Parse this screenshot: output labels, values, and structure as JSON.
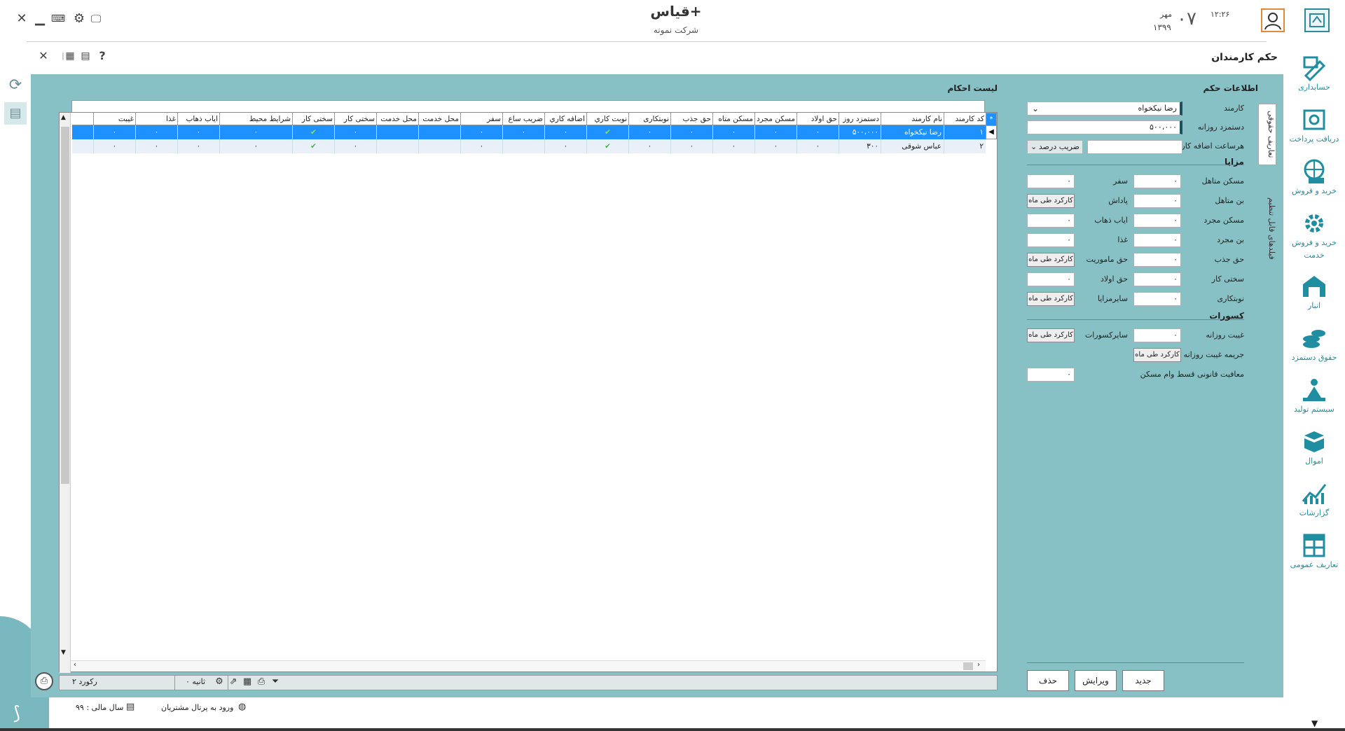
{
  "app": {
    "title": "قیاس+",
    "company": "شرکت نمونه",
    "time": "۱۲:۲۶",
    "day": "۰۷",
    "month": "مهر",
    "year": "۱۳۹۹"
  },
  "page_title": "حکم کارمندان",
  "form": {
    "section_title": "اطلاعات حکم",
    "employee_label": "کارمند",
    "employee_value": "رضا نیکخواه",
    "daily_wage_label": "دستمزد روزانه",
    "daily_wage_value": "۵۰۰،۰۰۰",
    "overtime_rate_label": "هرساعت اضافه کار",
    "overtime_rate_value": "",
    "overtime_mode": "ضریب درصد",
    "benefits_title": "مزایا",
    "deductions_title": "کسورات",
    "benefits_right": [
      {
        "label": "مسکن متاهل",
        "value": "۰"
      },
      {
        "label": "بن متاهل",
        "value": "۰"
      },
      {
        "label": "مسکن مجرد",
        "value": "۰"
      },
      {
        "label": "بن مجرد",
        "value": "۰"
      },
      {
        "label": "حق جذب",
        "value": "۰"
      },
      {
        "label": "سختی کار",
        "value": "۰"
      },
      {
        "label": "نوبتکاری",
        "value": "۰"
      }
    ],
    "benefits_left": [
      {
        "label": "سفر",
        "value": "۰",
        "button": ""
      },
      {
        "label": "پاداش",
        "value": "",
        "button": "کارکرد طی ماه"
      },
      {
        "label": "ایاب ذهاب",
        "value": "۰",
        "button": ""
      },
      {
        "label": "غذا",
        "value": "۰",
        "button": ""
      },
      {
        "label": "حق ماموریت",
        "value": "",
        "button": "کارکرد طی ماه"
      },
      {
        "label": "حق اولاد",
        "value": "۰",
        "button": ""
      },
      {
        "label": "سایرمزایا",
        "value": "",
        "button": "کارکرد طی ماه"
      }
    ],
    "daily_absence_label": "غیبت روزانه",
    "daily_absence_value": "۰",
    "other_deductions_label": "سایرکسورات",
    "other_deductions_button": "کارکرد طی ماه",
    "absence_penalty_label": "جریمه غیبت روزانه",
    "absence_penalty_button": "کارکرد طی ماه",
    "housing_loan_label": "معافیت قانونی قسط وام مسکن",
    "housing_loan_value": "۰",
    "buttons": {
      "new": "جدید",
      "edit": "ویرایش",
      "delete": "حذف"
    }
  },
  "vertical_tabs": {
    "tab1": "تعاریف حقوقی",
    "tab2": "فیلدهای قابل تنظیم"
  },
  "grid": {
    "title": "لیست احکام",
    "columns": [
      "کد کارمند",
      "نام کارمند",
      "دستمزد روز",
      "حق اولاد",
      "مسکن مجرد",
      "مسکن متاه",
      "حق جذب",
      "نوبتکاری",
      "نوبت کاري",
      "اضافه کاري",
      "ضریب ساع",
      "سفر",
      "محل خدمت",
      "محل خدمت",
      "سختی کار",
      "سختی کار",
      "شرایط محیط",
      "ایاب ذهاب",
      "غذا",
      "غیبت"
    ],
    "rows": [
      {
        "code": "۱",
        "name": "رضا نیکخواه",
        "wage": "۵۰۰،۰۰۰",
        "children": "۰",
        "house_single": "۰",
        "house_married": "۰",
        "attract": "۰",
        "shift": "۰",
        "shift_check": "✔",
        "overtime": "۰",
        "rate": "۰",
        "travel": "۰",
        "place1": "",
        "place2": "",
        "hard1": "۰",
        "hard_check": "✔",
        "env": "۰",
        "commute": "۰",
        "food": "۰",
        "absence": "۰"
      },
      {
        "code": "۲",
        "name": "عباس شوقی",
        "wage": "۳۰۰",
        "children": "۰",
        "house_single": "۰",
        "house_married": "۰",
        "attract": "۰",
        "shift": "۰",
        "shift_check": "✔",
        "overtime": "۰",
        "rate": "",
        "travel": "۰",
        "place1": "",
        "place2": "",
        "hard1": "۰",
        "hard_check": "✔",
        "env": "۰",
        "commute": "۰",
        "food": "۰",
        "absence": "۰"
      }
    ],
    "new_row_marker": "*",
    "current_row_marker": "◀",
    "footer_count": "۲ رکورد",
    "footer_timer": "۰ ثانیه"
  },
  "nav": [
    {
      "label": "حسابداری",
      "icon": "accounting-icon"
    },
    {
      "label": "دریافت پرداخت",
      "icon": "receive-pay-icon"
    },
    {
      "label": "خرید و فروش",
      "icon": "buy-sell-icon"
    },
    {
      "label": "خرید و فروش",
      "label2": "خدمت",
      "icon": "service-icon"
    },
    {
      "label": "انبار",
      "icon": "warehouse-icon"
    },
    {
      "label": "حقوق دستمزد",
      "icon": "payroll-icon"
    },
    {
      "label": "سیستم تولید",
      "icon": "production-icon"
    },
    {
      "label": "اموال",
      "icon": "assets-icon"
    },
    {
      "label": "گزارشات",
      "icon": "reports-icon"
    },
    {
      "label": "تعاریف عمومی",
      "icon": "definitions-icon"
    }
  ],
  "status": {
    "fiscal_year": "سال مالی : ۹۹",
    "portal": "ورود به پرتال مشتریان"
  },
  "colors": {
    "teal": "#87c1c6",
    "accent": "#1f8ea0",
    "selected": "#1e90ff"
  }
}
